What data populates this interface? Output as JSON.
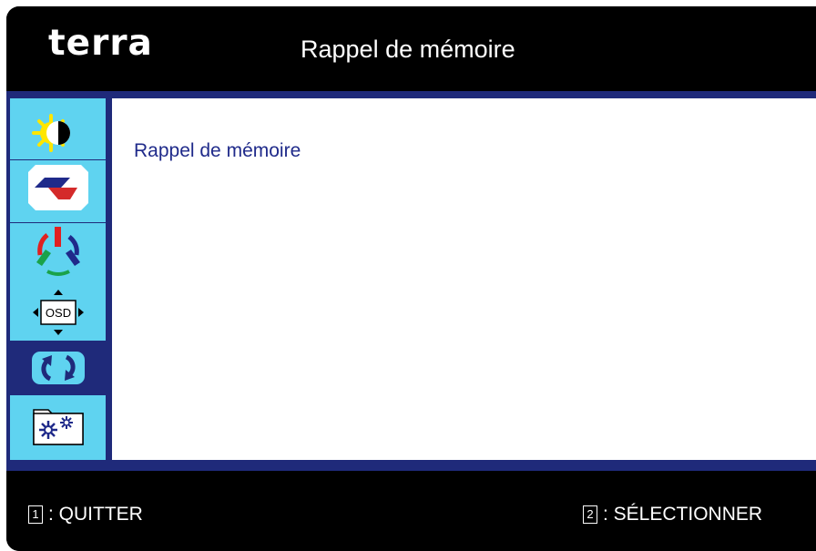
{
  "header": {
    "brand": "terra",
    "title": "Rappel de mémoire"
  },
  "sidebar": {
    "items": [
      {
        "name": "brightness-contrast-icon"
      },
      {
        "name": "image-position-icon"
      },
      {
        "name": "color-rgb-icon"
      },
      {
        "name": "osd-settings-icon"
      },
      {
        "name": "memory-recall-icon",
        "active": true
      },
      {
        "name": "extra-settings-icon"
      }
    ]
  },
  "content": {
    "items": [
      "Rappel de mémoire"
    ]
  },
  "footer": {
    "exit_key": "1",
    "exit_label": ": QUITTER",
    "select_key": "2",
    "select_label": ": SÉLECTIONNER"
  },
  "colors": {
    "frame": "#1f2a7a",
    "sidebar": "#5fd3f0",
    "content_bg": "#ffffff",
    "item_text": "#1f2a8a"
  }
}
